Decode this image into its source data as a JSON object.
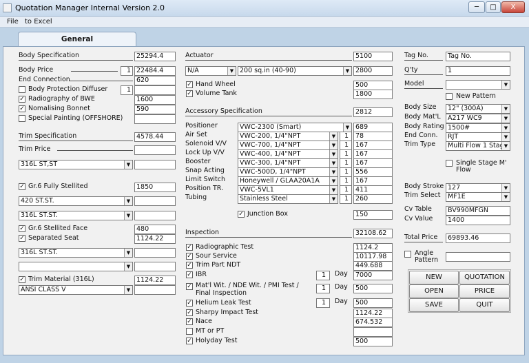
{
  "window": {
    "title": "Quotation Manager Internal Version 2.0",
    "min": "─",
    "restore": "□",
    "close": "X"
  },
  "menu": [
    "File",
    "to Excel"
  ],
  "tab": "General",
  "body_spec": {
    "label": "Body Specification",
    "value": "25294.4",
    "body_price": {
      "label": "Body Price",
      "qty": "1",
      "value": "22484.4"
    },
    "end_connection": {
      "label": "End Connection",
      "value": "620"
    },
    "protection_diffuser": {
      "label": "Body Protection Diffuser",
      "checked": false,
      "qty": "1",
      "value": ""
    },
    "radiography": {
      "label": "Radiography of BWE",
      "checked": true,
      "value": "1600"
    },
    "nomalising": {
      "label": "Nomalising Bonnet",
      "checked": true,
      "value": "590"
    },
    "special_painting": {
      "label": "Special Painting (OFFSHORE)",
      "checked": false,
      "value": ""
    }
  },
  "trim_spec": {
    "label": "Trim Specification",
    "value": "4578.44",
    "trim_price": {
      "label": "Trim Price",
      "value": ""
    },
    "mat1": {
      "selected": "316L ST,ST",
      "value": ""
    },
    "stellited": {
      "label": "Gr.6 Fully Stellited",
      "checked": true,
      "value": "1850"
    },
    "mat2": {
      "selected": "420 ST.ST.",
      "value": ""
    },
    "mat3": {
      "selected": "316L ST.ST.",
      "value": ""
    },
    "stellited_face": {
      "label": "Gr.6 Stellited Face",
      "checked": true,
      "value": "480"
    },
    "separated_seat": {
      "label": "Separated Seat",
      "checked": true,
      "value": "1124.22"
    },
    "mat4": {
      "selected": "316L ST.ST.",
      "value": ""
    },
    "mat5": {
      "selected": "",
      "value": ""
    },
    "trim_material": {
      "label": "Trim Material (316L)",
      "checked": true,
      "value": "1124.22"
    },
    "ansi": {
      "selected": "ANSI CLASS Ⅴ",
      "value": ""
    }
  },
  "actuator": {
    "label": "Actuator",
    "value": "5100",
    "type": "N/A",
    "size": "200 sq.in (40-90)",
    "size_value": "2800",
    "hand_wheel": {
      "label": "Hand Wheel",
      "checked": true,
      "value": "500"
    },
    "volume_tank": {
      "label": "Volume Tank",
      "checked": true,
      "value": "1800"
    }
  },
  "accessory": {
    "label": "Accessory Specification",
    "value": "2812",
    "rows": [
      {
        "label": "Positioner",
        "selected": "VWC-2300 (Smart)",
        "qty": "",
        "value": "689"
      },
      {
        "label": "Air Set",
        "selected": "VWC-200, 1/4\"NPT",
        "qty": "1",
        "value": "78"
      },
      {
        "label": "Solenoid V/V",
        "selected": "VWC-700, 1/4\"NPT",
        "qty": "1",
        "value": "167"
      },
      {
        "label": "Lock Up V/V",
        "selected": "VWC-400, 1/4\"NPT",
        "qty": "1",
        "value": "167"
      },
      {
        "label": "Booster",
        "selected": "VWC-300, 1/4\"NPT",
        "qty": "1",
        "value": "167"
      },
      {
        "label": "Snap Acting",
        "selected": "VWC-500D, 1/4\"NPT",
        "qty": "1",
        "value": "556"
      },
      {
        "label": "Limit Switch",
        "selected": "Honeywell / GLAA20A1A",
        "qty": "1",
        "value": "167"
      },
      {
        "label": "Position TR.",
        "selected": "VWC-5VL1",
        "qty": "1",
        "value": "411"
      },
      {
        "label": "Tubing",
        "selected": "Stainless Steel",
        "qty": "1",
        "value": "260"
      }
    ],
    "junction": {
      "label": "Junction Box",
      "checked": true,
      "value": "150"
    }
  },
  "inspection": {
    "label": "Inspection",
    "value": "32108.62",
    "day": "Day",
    "rows": [
      {
        "label": "Radiographic Test",
        "checked": true,
        "value": "1124.2"
      },
      {
        "label": "Sour Service",
        "checked": true,
        "value": "10117.98"
      },
      {
        "label": "Trim Part NDT",
        "checked": true,
        "value": "449.688"
      },
      {
        "label": "IBR",
        "checked": true,
        "days": "1",
        "value": "7000"
      },
      {
        "label": "Mat'l Wit. / NDE Wit. / PMI Test /",
        "label2": "Final Inspection",
        "checked": true,
        "days": "1",
        "value": "500"
      },
      {
        "label": "Helium Leak Test",
        "checked": true,
        "days": "1",
        "value": "500"
      },
      {
        "label": "Sharpy Impact Test",
        "checked": true,
        "value": "1124.22"
      },
      {
        "label": "Nace",
        "checked": true,
        "value": "674.532"
      },
      {
        "label": "MT or PT",
        "checked": false,
        "value": ""
      },
      {
        "label": "Holyday Test",
        "checked": true,
        "value": "500"
      }
    ]
  },
  "right": {
    "tag_no": {
      "label": "Tag No.",
      "value": "Tag No."
    },
    "qty": {
      "label": "Q'ty",
      "value": "1"
    },
    "model": {
      "label": "Model",
      "selected": ""
    },
    "new_pattern": {
      "label": "New Pattern",
      "checked": false
    },
    "body_size": {
      "label": "Body Size",
      "selected": "12\" (300A)"
    },
    "body_matl": {
      "label": "Body Mat'L",
      "selected": "A217 WC9"
    },
    "body_rating": {
      "label": "Body Rating",
      "selected": "1500#"
    },
    "end_conn": {
      "label": "End Conn.",
      "selected": "RJT"
    },
    "trim_type": {
      "label": "Trim Type",
      "selected": "Multi Flow 1 Stag"
    },
    "single_stage": {
      "label": "Single Stage M'",
      "label2": "Flow",
      "checked": false
    },
    "body_stroke": {
      "label": "Body Stroke",
      "selected": "127"
    },
    "trim_select": {
      "label": "Trim Select",
      "selected": "MF1E"
    },
    "cv_table": {
      "label": "Cv Table",
      "value": "BV990MFGN"
    },
    "cv_value": {
      "label": "Cv Value",
      "value": "1400"
    },
    "total_price": {
      "label": "Total Price",
      "value": "69893.46"
    },
    "angle": {
      "label": "Angle",
      "label2": "Pattern",
      "checked": false,
      "value": ""
    }
  },
  "buttons": {
    "new": "NEW",
    "quotation": "QUOTATION",
    "open": "OPEN",
    "price": "PRICE",
    "save": "SAVE",
    "quit": "QUIT"
  }
}
